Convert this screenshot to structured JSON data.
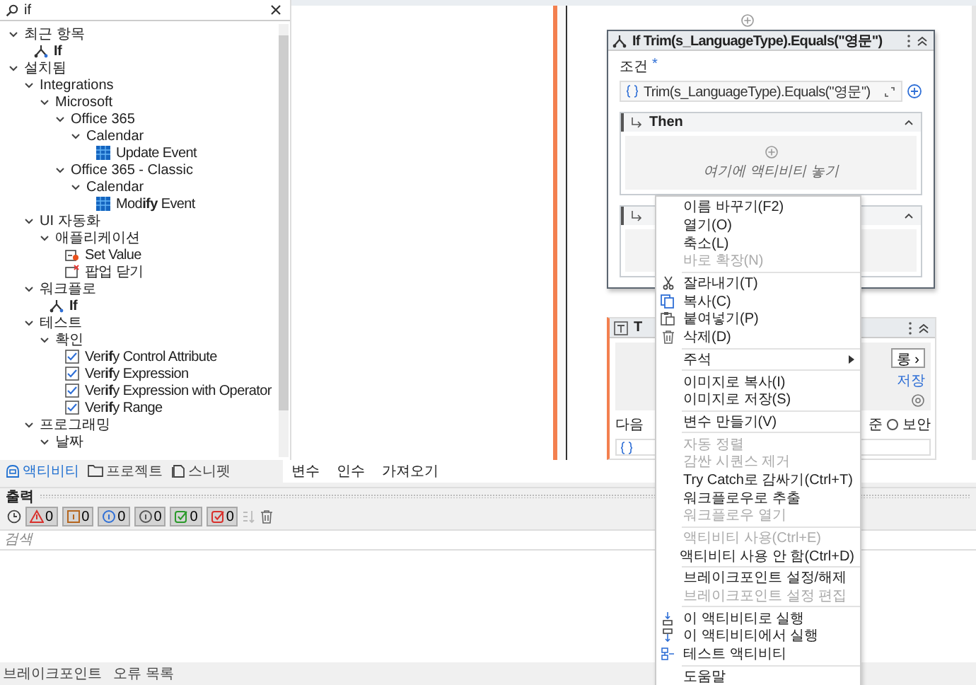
{
  "search": {
    "value": "if"
  },
  "tree": [
    {
      "label": "최근 항목",
      "expanded": true,
      "children": [
        {
          "label": "**If**",
          "kind": "branch"
        }
      ]
    },
    {
      "label": "설치됨",
      "expanded": true,
      "children": [
        {
          "label": "Integrations",
          "expanded": true,
          "children": [
            {
              "label": "Microsoft",
              "expanded": true,
              "children": [
                {
                  "label": "Office 365",
                  "expanded": true,
                  "children": [
                    {
                      "label": "Calendar",
                      "expanded": true,
                      "children": [
                        {
                          "label": "Update Event",
                          "kind": "tile"
                        }
                      ]
                    }
                  ]
                },
                {
                  "label": "Office 365 - Classic",
                  "expanded": true,
                  "children": [
                    {
                      "label": "Calendar",
                      "expanded": true,
                      "children": [
                        {
                          "label": "Mod**ify** Event",
                          "kind": "tile"
                        }
                      ]
                    }
                  ]
                }
              ]
            }
          ]
        },
        {
          "label": "UI 자동화",
          "expanded": true,
          "children": [
            {
              "label": "애플리케이션",
              "expanded": true,
              "children": [
                {
                  "label": "Set Value",
                  "kind": "set-value"
                },
                {
                  "label": "팝업 닫기",
                  "kind": "close-popup"
                }
              ]
            }
          ]
        },
        {
          "label": "워크플로",
          "expanded": true,
          "children": [
            {
              "label": "**If**",
              "kind": "branch"
            }
          ]
        },
        {
          "label": "테스트",
          "expanded": true,
          "children": [
            {
              "label": "확인",
              "expanded": true,
              "children": [
                {
                  "label": "Ver**if**y Control Attribute",
                  "kind": "check"
                },
                {
                  "label": "Ver**if**y Expression",
                  "kind": "check"
                },
                {
                  "label": "Ver**if**y Expression with Operator",
                  "kind": "check"
                },
                {
                  "label": "Ver**if**y Range",
                  "kind": "check"
                }
              ]
            }
          ]
        },
        {
          "label": "프로그래밍",
          "expanded": true,
          "children": [
            {
              "label": "날짜",
              "expanded": true
            }
          ]
        }
      ]
    }
  ],
  "panel_tabs": [
    {
      "label": "액티비티",
      "selected": true,
      "kind": "activity"
    },
    {
      "label": "프로젝트",
      "selected": false,
      "kind": "folder"
    },
    {
      "label": "스니펫",
      "selected": false,
      "kind": "snippet"
    }
  ],
  "designer_tabs": [
    "변수",
    "인수",
    "가져오기"
  ],
  "if_card": {
    "title": "If Trim(s_LanguageType).Equals(\"영문\")",
    "condition_label": "조건",
    "required_mark": "*",
    "condition": "Trim(s_LanguageType).Equals(\"영문\")",
    "then_label": "Then",
    "drop_hint": "여기에 액티비티 놓기"
  },
  "second_card": {
    "title": "T",
    "button": "롱 ›",
    "link": "저장",
    "field_label": "다음",
    "option": "준",
    "radio_label": "보안",
    "radio_selected": false
  },
  "output": {
    "title": "출력",
    "filters": [
      {
        "kind": "warning",
        "count": "0",
        "selected": true
      },
      {
        "kind": "error",
        "count": "0",
        "selected": true
      },
      {
        "kind": "info",
        "count": "0",
        "selected": true
      },
      {
        "kind": "trace",
        "count": "0",
        "selected": true
      },
      {
        "kind": "pass",
        "count": "0",
        "selected": true
      },
      {
        "kind": "fail",
        "count": "0",
        "selected": true
      }
    ],
    "search": {
      "placeholder": "검색"
    }
  },
  "bottom_tabs": [
    "브레이크포인트",
    "오류 목록"
  ],
  "context_menu": [
    {
      "kind": "plain",
      "label": "이름 바꾸기(F2)",
      "disabled": false
    },
    {
      "kind": "plain",
      "label": "열기(O)",
      "disabled": false
    },
    {
      "kind": "plain",
      "label": "축소(L)",
      "disabled": false
    },
    {
      "kind": "plain",
      "label": "바로 확장(N)",
      "disabled": true
    },
    {
      "kind": "separator"
    },
    {
      "kind": "cut",
      "label": "잘라내기(T)",
      "disabled": false
    },
    {
      "kind": "copy",
      "label": "복사(C)",
      "disabled": false
    },
    {
      "kind": "paste",
      "label": "붙여넣기(P)",
      "disabled": false
    },
    {
      "kind": "delete",
      "label": "삭제(D)",
      "disabled": false
    },
    {
      "kind": "separator"
    },
    {
      "kind": "submenu",
      "label": "주석",
      "disabled": false
    },
    {
      "kind": "separator"
    },
    {
      "kind": "plain",
      "label": "이미지로 복사(I)",
      "disabled": false
    },
    {
      "kind": "plain",
      "label": "이미지로 저장(S)",
      "disabled": false
    },
    {
      "kind": "separator"
    },
    {
      "kind": "plain",
      "label": "변수 만들기(V)",
      "disabled": false
    },
    {
      "kind": "separator"
    },
    {
      "kind": "plain",
      "label": "자동 정렬",
      "disabled": true
    },
    {
      "kind": "plain",
      "label": "감싼 시퀀스 제거",
      "disabled": true
    },
    {
      "kind": "plain",
      "label": "Try Catch로 감싸기(Ctrl+T)",
      "disabled": false
    },
    {
      "kind": "plain",
      "label": "워크플로우로 추출",
      "disabled": false
    },
    {
      "kind": "plain",
      "label": "워크플로우 열기",
      "disabled": true
    },
    {
      "kind": "separator"
    },
    {
      "kind": "plain",
      "label": "액티비티 사용(Ctrl+E)",
      "disabled": true
    },
    {
      "kind": "plain",
      "label": "액티비티 사용 안 함(Ctrl+D)",
      "disabled": false
    },
    {
      "kind": "separator"
    },
    {
      "kind": "plain",
      "label": "브레이크포인트 설정/해제",
      "disabled": false
    },
    {
      "kind": "plain",
      "label": "브레이크포인트 설정 편집",
      "disabled": true
    },
    {
      "kind": "separator"
    },
    {
      "kind": "run-to",
      "label": "이 액티비티로 실행",
      "disabled": false
    },
    {
      "kind": "run-from",
      "label": "이 액티비티에서 실행",
      "disabled": false
    },
    {
      "kind": "test",
      "label": "테스트 액티비티",
      "disabled": false
    },
    {
      "kind": "separator"
    },
    {
      "kind": "plain",
      "label": "도움말",
      "disabled": false
    }
  ]
}
